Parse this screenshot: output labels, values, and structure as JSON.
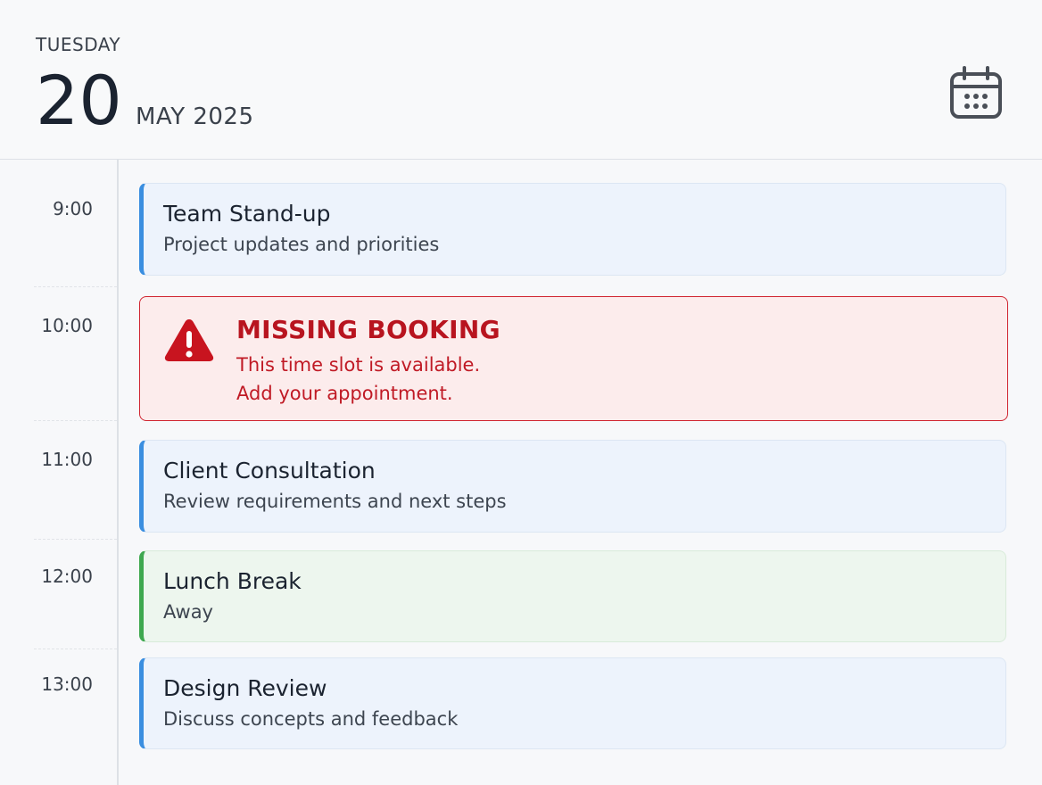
{
  "header": {
    "weekday": "TUESDAY",
    "day": "20",
    "month_year": "MAY 2025",
    "calendar_icon": "calendar-icon"
  },
  "times": [
    "9:00",
    "10:00",
    "11:00",
    "12:00",
    "13:00"
  ],
  "events": [
    {
      "title": "Team Stand-up",
      "description": "Project updates and priorities",
      "color": "#3a8ee0"
    },
    {
      "title": "Client Consultation",
      "description": "Review requirements and next steps",
      "color": "#3a8ee0"
    },
    {
      "title": "Lunch Break",
      "description": "Away",
      "color": "#3ea84f"
    },
    {
      "title": "Design Review",
      "description": "Discuss concepts and feedback",
      "color": "#3a8ee0"
    }
  ],
  "alert": {
    "title": "MISSING BOOKING",
    "line1": "This time slot is available.",
    "line2": "Add your appointment.",
    "icon": "warning-icon",
    "color": "#c01a25"
  }
}
